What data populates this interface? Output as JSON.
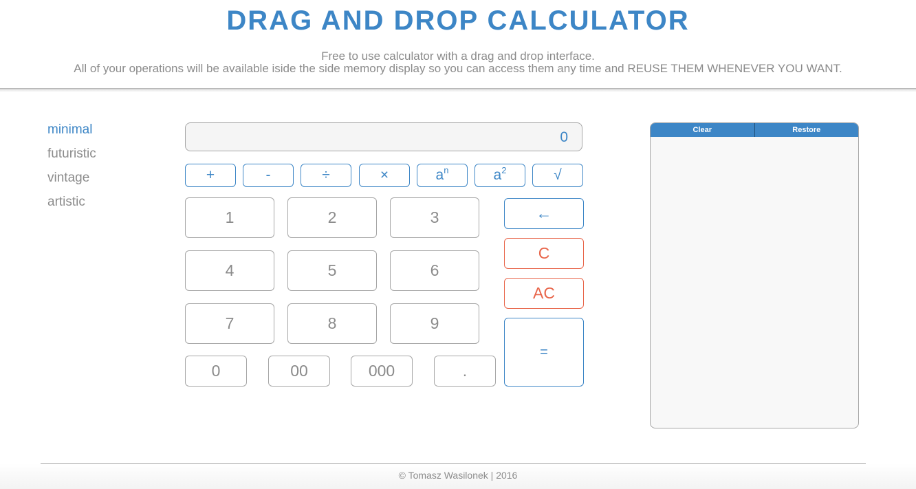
{
  "header": {
    "title": "DRAG AND DROP CALCULATOR",
    "subtitle_line1": "Free to use calculator with a drag and drop interface.",
    "subtitle_line2": "All of your operations will be available iside the side memory display so you can access them any time and REUSE THEM WHENEVER YOU WANT."
  },
  "themes": {
    "active": "minimal",
    "items": [
      "minimal",
      "futuristic",
      "vintage",
      "artistic"
    ]
  },
  "display": {
    "value": "0"
  },
  "operators": {
    "add": "+",
    "subtract": "-",
    "divide": "÷",
    "multiply": "×",
    "power_base": "a",
    "power_exp": "n",
    "square_base": "a",
    "square_exp": "2",
    "sqrt": "√"
  },
  "digits": [
    "1",
    "2",
    "3",
    "4",
    "5",
    "6",
    "7",
    "8",
    "9"
  ],
  "zeros": [
    "0",
    "00",
    "000",
    "."
  ],
  "controls": {
    "backspace": "←",
    "clear": "C",
    "all_clear": "AC",
    "equals": "="
  },
  "memory": {
    "clear_label": "Clear",
    "restore_label": "Restore",
    "entries": []
  },
  "footer": {
    "text": "© Tomasz Wasilonek | 2016"
  },
  "colors": {
    "accent": "#3d86c6",
    "danger": "#e8654a",
    "text_muted": "#8b8b8b",
    "border": "#a6a6a6"
  }
}
